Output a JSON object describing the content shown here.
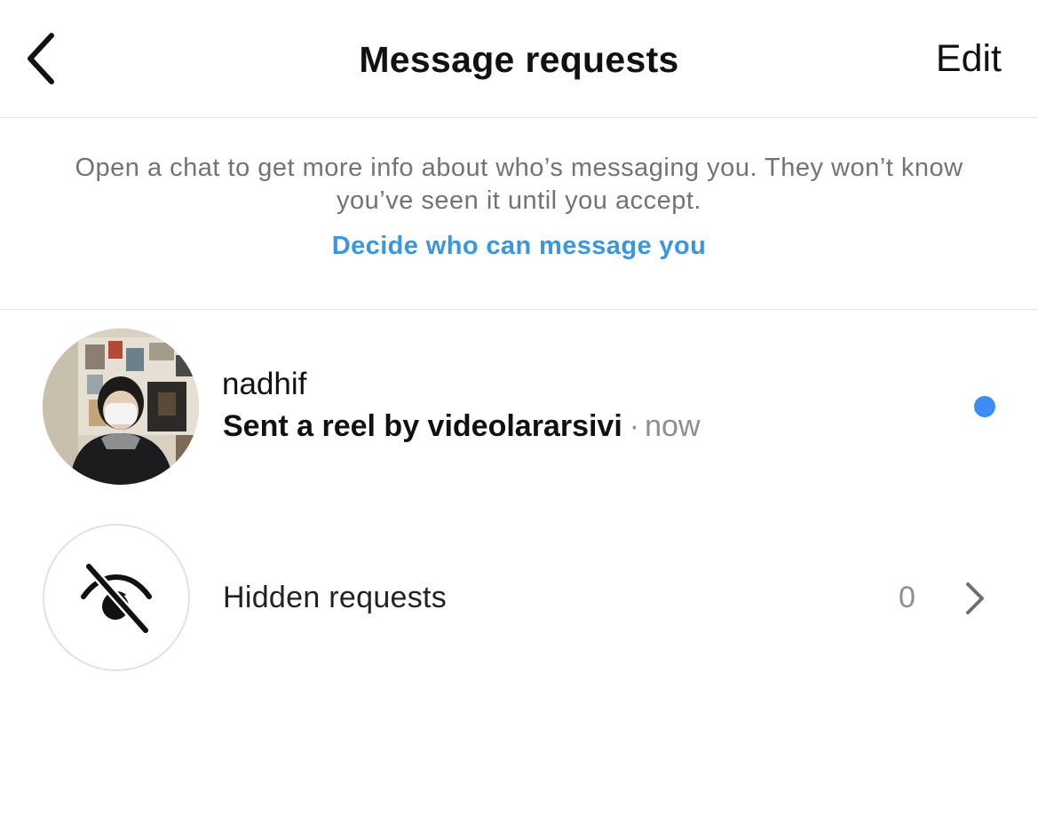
{
  "header": {
    "title": "Message requests",
    "edit_label": "Edit",
    "back_icon": "chevron-left-icon"
  },
  "info": {
    "text": "Open a chat to get more info about who’s messaging you. They won’t know you’ve seen it until you accept.",
    "link_label": "Decide who can message you",
    "link_color": "#3b96e0"
  },
  "requests": [
    {
      "name": "nadhif",
      "message": "Sent a reel by videolararsivi",
      "separator": "·",
      "time": "now",
      "unread": true,
      "unread_color": "#3b8cf5"
    }
  ],
  "hidden_requests": {
    "label": "Hidden requests",
    "count": "0",
    "icon": "eye-slash-icon",
    "chevron_icon": "chevron-right-icon"
  }
}
